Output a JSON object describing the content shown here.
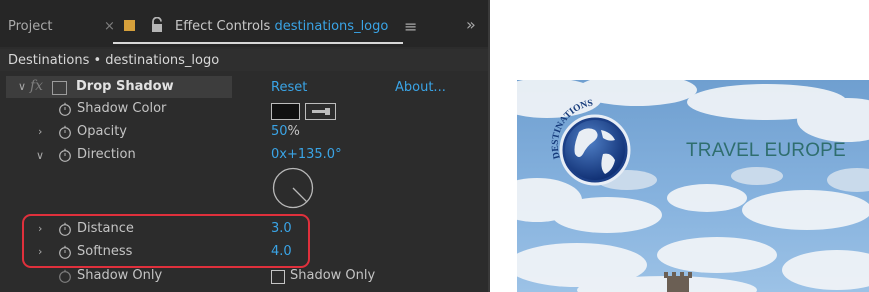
{
  "tabs": {
    "project_label": "Project",
    "close_glyph": "×",
    "effect_controls_label": "Effect Controls",
    "clip_name": "destinations_logo",
    "menu_glyph": "≡",
    "overflow_glyph": "»"
  },
  "breadcrumb": "Destinations • destinations_logo",
  "effect": {
    "name": "Drop Shadow",
    "fx_label": "fx",
    "reset_label": "Reset",
    "about_label": "About..."
  },
  "properties": {
    "shadow_color": {
      "label": "Shadow Color"
    },
    "opacity": {
      "label": "Opacity",
      "value": "50",
      "unit": "%"
    },
    "direction": {
      "label": "Direction",
      "value_prefix": "0x",
      "value": "+135.0°",
      "angle_deg": 135
    },
    "distance": {
      "label": "Distance",
      "value": "3.0"
    },
    "softness": {
      "label": "Softness",
      "value": "4.0"
    },
    "shadow_only": {
      "label": "Shadow Only",
      "checkbox_label": "Shadow Only",
      "checked": false
    }
  },
  "preview": {
    "logo_arc_text": "DESTINATIONS",
    "headline": "TRAVEL EUROPE"
  },
  "colors": {
    "link_blue": "#3aa4e6",
    "highlight_red": "#e0303c",
    "panel_bg": "#2c2c2c",
    "shadow_color_swatch": "#111111",
    "headline_teal": "#2f6e6e"
  },
  "icons": {
    "lock": "lock-icon",
    "stopwatch": "stopwatch-icon",
    "eyedropper": "eyedropper-icon",
    "fx": "fx-badge-icon",
    "toggle_effect": "effect-toggle-icon"
  }
}
